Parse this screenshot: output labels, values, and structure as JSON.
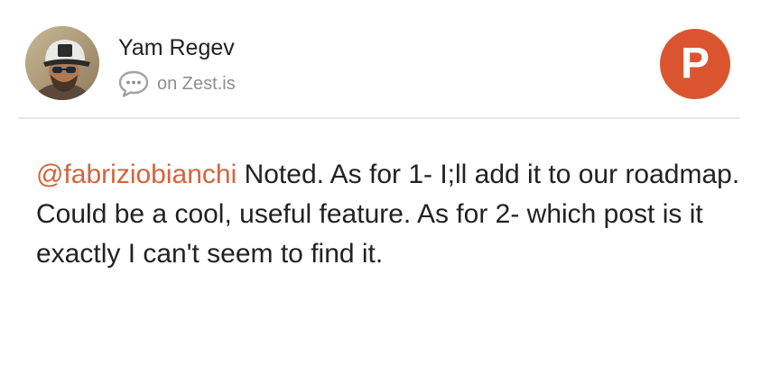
{
  "comment": {
    "author_name": "Yam Regev",
    "source_icon": "chat-bubble-icon",
    "source_label": "on Zest.is",
    "badge_icon": "product-hunt-icon",
    "badge_letter": "P",
    "mention": "@fabriziobianchi",
    "body": " Noted. As for 1- I;ll add it to our roadmap. Could be a cool, useful feature. As for 2- which post is it exactly I can't seem to find it."
  },
  "colors": {
    "badge": "#da552f",
    "mention": "#d5633d",
    "text": "#222222",
    "muted": "#8e8e8e",
    "divider": "#e6e6e6"
  }
}
